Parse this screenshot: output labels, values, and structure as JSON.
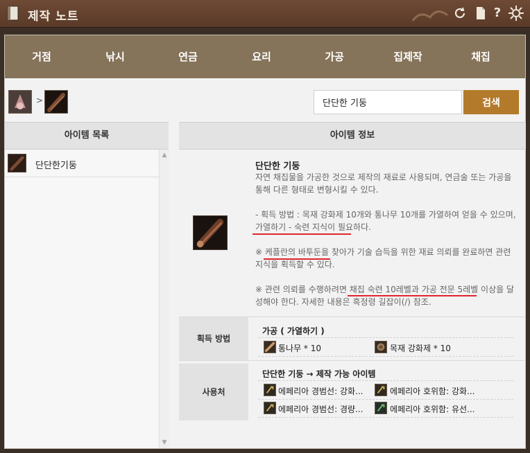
{
  "window": {
    "title": "제작 노트"
  },
  "categories": [
    "거점",
    "낚시",
    "연금",
    "요리",
    "가공",
    "집제작",
    "채집"
  ],
  "search": {
    "value": "단단한 기둥",
    "button_label": "검색"
  },
  "breadcrumb": {
    "separator": ">"
  },
  "left_panel": {
    "header": "아이템 목록",
    "items": [
      {
        "label": "단단한기둥"
      }
    ]
  },
  "right_panel": {
    "header": "아이템 정보",
    "item_name": "단단한 기둥",
    "description": [
      "자연 채집물을 가공한 것으로 제작의 재료로 사용되며, 연금술 또는 가공을",
      "통해 다른 형태로 변형시킬 수 있다.",
      "",
      "- 획득 방법 : 목재 강화제 10개와 통나무 10개를 가열하여 얻을 수 있으며,",
      "가열하기 - 숙련 지식이 필요하다.",
      "",
      "※ 케플란의 바투둔을 찾아가 기술 습득을 위한 재료 의뢰를 완료하면 관련",
      "지식을 획득할 수 있다.",
      "",
      "※ 관련 의뢰를 수행하려면 채집 숙련 10레벨과 가공 전문 5레벨 이상을 달",
      "성해야 한다. 자세한 내용은 흑정령 길잡이(/) 참조."
    ],
    "obtain": {
      "label": "획득 방법",
      "title": "가공 ( 가열하기 )",
      "materials": [
        {
          "name": "통나무 * 10",
          "icon": "log-icon"
        },
        {
          "name": "목재 강화제 * 10",
          "icon": "wood-reinforcer-icon"
        }
      ]
    },
    "usage": {
      "label": "사용처",
      "title": "단단한 기둥 → 제작 가능 아이템",
      "items": [
        {
          "name": "에페리아 경범선: 강화...",
          "icon": "ship-part-icon"
        },
        {
          "name": "에페리아 호위함: 강화...",
          "icon": "ship-part-icon"
        },
        {
          "name": "에페리아 경범선: 경량...",
          "icon": "ship-part-icon"
        },
        {
          "name": "에페리아 호위함: 유선...",
          "icon": "ship-part-icon"
        }
      ]
    }
  },
  "colors": {
    "titlebar": "#5a3a28",
    "category_bar": "#85735a",
    "search_button": "#b37a2b",
    "underline": "#e0252b"
  }
}
